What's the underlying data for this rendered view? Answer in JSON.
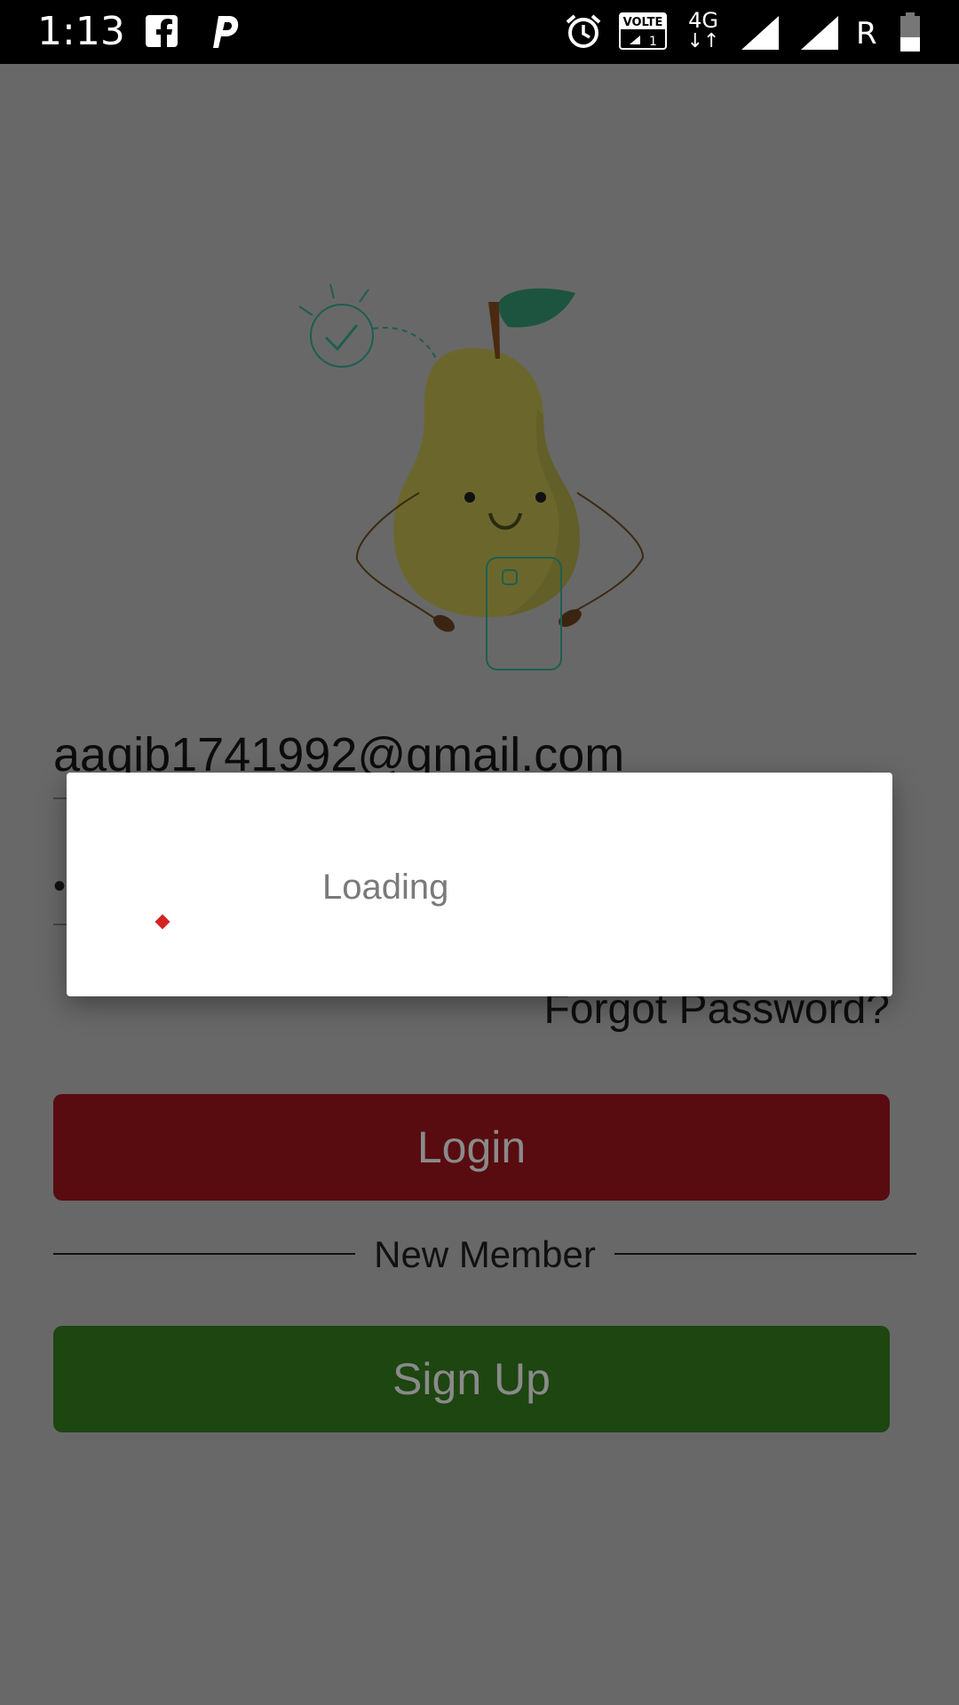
{
  "status_bar": {
    "time": "1:13",
    "network": "4G",
    "roaming": "R",
    "icons": [
      "facebook-icon",
      "p-app-icon",
      "alarm-icon",
      "volte-icon",
      "signal-icon",
      "signal-icon",
      "battery-icon"
    ],
    "volte_label": "VOLTE",
    "volte_sub": "1"
  },
  "login": {
    "email_value": "aaqib1741992@gmail.com",
    "password_mask": "•",
    "forgot_label": "Forgot Password?",
    "login_label": "Login",
    "divider_label": "New Member",
    "signup_label": "Sign Up"
  },
  "dialog": {
    "message": "Loading"
  },
  "colors": {
    "overlay_bg": "#686868",
    "login_button": "#580c10",
    "signup_button": "#1d4610",
    "spinner": "#d32222"
  }
}
